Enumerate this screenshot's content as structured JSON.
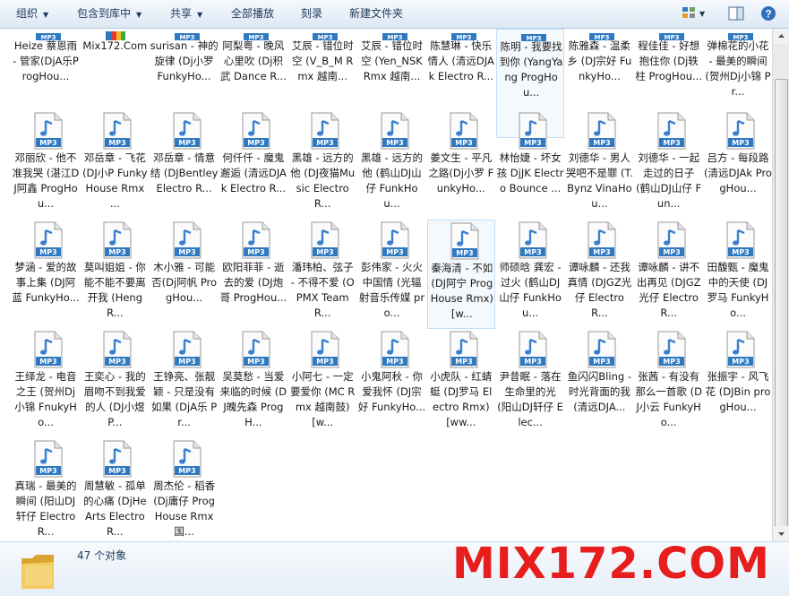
{
  "toolbar": {
    "organize": "组织",
    "include_in_library": "包含到库中",
    "share": "共享",
    "play_all": "全部播放",
    "burn": "刻录",
    "new_folder": "新建文件夹"
  },
  "icon_label": "MP3",
  "files": [
    {
      "name": "Heize 蔡恩雨 - 管家(DjA乐ProgHou..."
    },
    {
      "name": "Mix172.Com"
    },
    {
      "name": "surisan - 神的旋律 (Dj小罗 FunkyHo..."
    },
    {
      "name": "阿梨粤 - 晚风心里吹 (Dj积武 Dance R..."
    },
    {
      "name": "艾辰 - 错位时空 (V_B_M Rmx 越南..."
    },
    {
      "name": "艾辰 - 错位时空 (Yen_NSK Rmx 越南..."
    },
    {
      "name": "陈慧琳 - 快乐情人 (清远DJAk Electro R..."
    },
    {
      "name": "陈明 - 我要找到你 (YangYang ProgHou..."
    },
    {
      "name": "陈雅森 - 温柔乡 (DJ宗好 FunkyHo..."
    },
    {
      "name": "程佳佳 - 好想抱住你 (Dj轶柱 ProgHou..."
    },
    {
      "name": "弹棉花的小花 - 最美的瞬间 (贺州Dj小锦 Pr..."
    },
    {
      "name": "邓丽欣 - 他不准我哭 (湛江DJ阿鑫 ProgHou..."
    },
    {
      "name": "邓岳章 - 飞花 (DJ小P FunkyHouse Rmx ..."
    },
    {
      "name": "邓岳章 - 情意结 (DJBentley Electro R..."
    },
    {
      "name": "何仟仟 - 魔鬼邂逅 (清远DJAk Electro R..."
    },
    {
      "name": "黑雄 - 远方的他 (DJ夜猫Music Electro R..."
    },
    {
      "name": "黑雄 - 远方的他 (鹤山DJ山仔 FunkHou..."
    },
    {
      "name": "姜文生 - 平凡之路(Dj小罗 FunkyHo..."
    },
    {
      "name": "林怡婕 - 坏女孩 DjJK Electro Bounce ..."
    },
    {
      "name": "刘德华 - 男人哭吧不是罪 (T.Bynz VinaHou..."
    },
    {
      "name": "刘德华 - 一起走过的日子 (鹤山DJ山仔 Fun..."
    },
    {
      "name": "吕方 - 每段路 (清远DJAk ProgHou..."
    },
    {
      "name": "梦涵 - 爱的故事上集 (DJ阿蓝 FunkyHo..."
    },
    {
      "name": "莫叫姐姐 - 你能不能不要离开我 (Heng R..."
    },
    {
      "name": "木小雅 - 可能否(Dj阿帆 ProgHou..."
    },
    {
      "name": "欧阳菲菲 - 逝去的爱 (DJ炮哥 ProgHou..."
    },
    {
      "name": "潘玮柏、弦子 - 不得不爱 (OPMX Team R..."
    },
    {
      "name": "彭伟家 - 火火中国情 (光辐射音乐传媒 pro..."
    },
    {
      "name": "秦海清 - 不如 (DJ阿宁 ProgHouse Rmx)[w..."
    },
    {
      "name": "师硕晗 龚宏 - 过火 (鹤山DJ山仔 FunkHou..."
    },
    {
      "name": "谭咏麟 - 还我真情 (DJGZ光仔 Electro R..."
    },
    {
      "name": "谭咏麟 - 讲不出再见 (DJGZ光仔 Electro R..."
    },
    {
      "name": "田馥甄 - 魔鬼中的天使 (DJ罗马 FunkyHo..."
    },
    {
      "name": "王绎龙 - 电音之王 (贺州Dj小锦 FnukyHo..."
    },
    {
      "name": "王奕心 - 我的眉吻不到我爱的人 (DJ小煜 P..."
    },
    {
      "name": "王铮亮、张靓颖 - 只是没有如果 (DjA乐 Pr..."
    },
    {
      "name": "吴莫愁 - 当爱来临的时候 (DJ魄先森 ProgH..."
    },
    {
      "name": "小阿七 - 一定要爱你 (MC Rmx 越南鼓)[w..."
    },
    {
      "name": "小鬼阿秋 - 你爱我怀 (DJ宗好 FunkyHo..."
    },
    {
      "name": "小虎队 - 红蜻蜓 (DJ罗马 Electro Rmx)[ww..."
    },
    {
      "name": "尹昔眠 - 落在生命里的光 (阳山DJ轩仔 Elec..."
    },
    {
      "name": "鱼闪闪Bling - 时光背面的我 (清远DJA..."
    },
    {
      "name": "张茜 - 有没有那么一首歌 (DJ小云 FunkyHo..."
    },
    {
      "name": "张振宇 - 风飞花 (DJBin progHou..."
    },
    {
      "name": "真瑞 - 最美的瞬间 (阳山DJ轩仔 Electro R..."
    },
    {
      "name": "周慧敏 - 孤单的心痛 (DjHeArts Electro R..."
    },
    {
      "name": "周杰伦 - 稻香(Dj庸仔 ProgHouse Rmx国..."
    }
  ],
  "status": {
    "count": "47 个对象"
  },
  "watermark": "MIX172.COM",
  "colors": {
    "toolbar_text": "#1e395b",
    "mp3_badge": "#2f79c2",
    "watermark": "#e61e1e"
  }
}
